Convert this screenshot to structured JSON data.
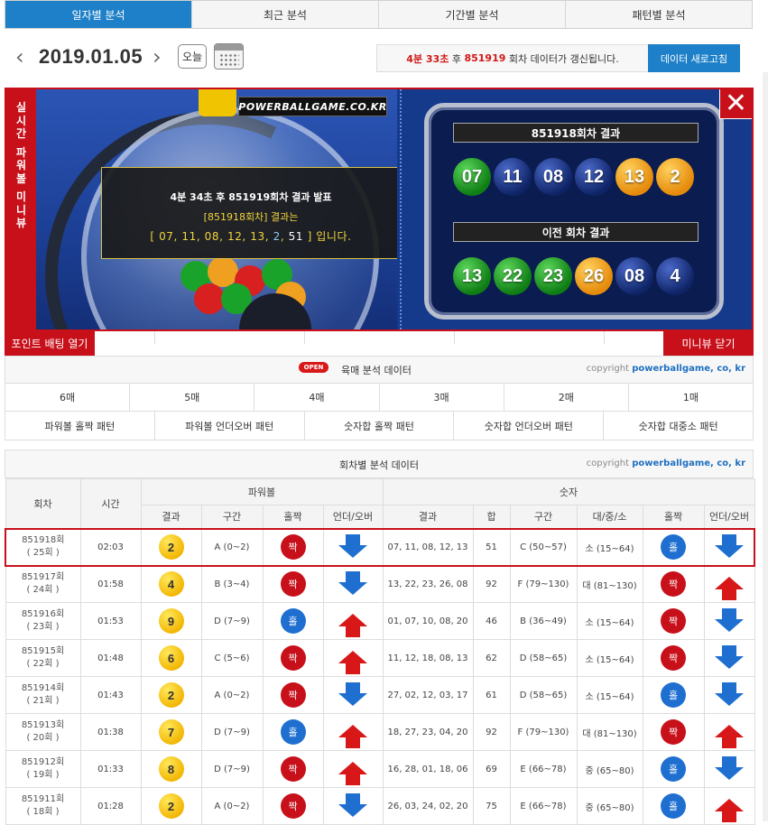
{
  "tabs": [
    "일자별 분석",
    "최근 분석",
    "기간별 분석",
    "패턴별 분석"
  ],
  "date": {
    "value": "2019.01.05",
    "today_label": "오늘"
  },
  "notice": {
    "countdown": "4분 33초",
    "after": " 후 ",
    "round": "851919",
    "text": " 회차 데이터가 갱신됩니다."
  },
  "refresh_label": "데이터 새로고침",
  "mini": {
    "side_label": [
      "실",
      "시",
      "간",
      "파",
      "워",
      "볼",
      "미",
      "니",
      "뷰"
    ],
    "brand": "POWERBALLGAME.CO.KR",
    "announce_l1": "4분 34초 후 851919회차 결과 발표",
    "announce_l2": "[851918회차] 결과는",
    "announce_prefix": "[ 07, 11, 08, 12, 13, ",
    "announce_pb": "2",
    "announce_sep": ", ",
    "announce_sum": "51",
    "announce_suffix": " ] 입니다.",
    "current_title": "851918회차 결과",
    "current_balls": [
      "07",
      "11",
      "08",
      "12",
      "13",
      "2"
    ],
    "prev_title": "이전 회차 결과",
    "prev_balls": [
      "13",
      "22",
      "23",
      "26",
      "08",
      "4"
    ],
    "close": "✕",
    "point_btn": "포인트 배팅 열기",
    "minimize_btn": "미니뷰 닫기"
  },
  "colors": {
    "accent": "#1e80c8",
    "red": "#c8101a",
    "ball_green": "#0e7d14",
    "ball_navy": "#0f2467",
    "ball_orange": "#e58a0a"
  },
  "buy": {
    "badge": "OPEN",
    "title": "육매 분석 데이터",
    "copyright_prefix": "copyright ",
    "copyright_site": "powerballgame, co, kr",
    "counts": [
      "6매",
      "5매",
      "4매",
      "3매",
      "2매",
      "1매"
    ],
    "patterns": [
      "파워볼 홀짝 패턴",
      "파워볼 언더오버 패턴",
      "숫자합 홀짝 패턴",
      "숫자합 언더오버 패턴",
      "숫자합 대중소 패턴"
    ]
  },
  "analysis": {
    "title": "회차별 분석 데이터",
    "copyright_prefix": "copyright ",
    "copyright_site": "powerballgame, co, kr",
    "h_round": "회차",
    "h_time": "시간",
    "h_powerball": "파워볼",
    "h_numbers": "숫자",
    "sub": [
      "결과",
      "구간",
      "홀짝",
      "언더/오버",
      "결과",
      "합",
      "구간",
      "대/중/소",
      "홀짝",
      "언더/오버"
    ],
    "rows": [
      {
        "round": "851918회",
        "sub": "( 25회 )",
        "time": "02:03",
        "pb": "2",
        "pb_range": "A (0~2)",
        "pb_oe": "짝",
        "pb_ud": "down",
        "nums": "07, 11, 08, 12, 13",
        "sum": "51",
        "sum_range": "C (50~57)",
        "size": "소 (15~64)",
        "oe": "홀",
        "ud": "down"
      },
      {
        "round": "851917회",
        "sub": "( 24회 )",
        "time": "01:58",
        "pb": "4",
        "pb_range": "B (3~4)",
        "pb_oe": "짝",
        "pb_ud": "down",
        "nums": "13, 22, 23, 26, 08",
        "sum": "92",
        "sum_range": "F (79~130)",
        "size": "대 (81~130)",
        "oe": "짝",
        "ud": "up"
      },
      {
        "round": "851916회",
        "sub": "( 23회 )",
        "time": "01:53",
        "pb": "9",
        "pb_range": "D (7~9)",
        "pb_oe": "홀",
        "pb_ud": "up",
        "nums": "01, 07, 10, 08, 20",
        "sum": "46",
        "sum_range": "B (36~49)",
        "size": "소 (15~64)",
        "oe": "짝",
        "ud": "down"
      },
      {
        "round": "851915회",
        "sub": "( 22회 )",
        "time": "01:48",
        "pb": "6",
        "pb_range": "C (5~6)",
        "pb_oe": "짝",
        "pb_ud": "up",
        "nums": "11, 12, 18, 08, 13",
        "sum": "62",
        "sum_range": "D (58~65)",
        "size": "소 (15~64)",
        "oe": "짝",
        "ud": "down"
      },
      {
        "round": "851914회",
        "sub": "( 21회 )",
        "time": "01:43",
        "pb": "2",
        "pb_range": "A (0~2)",
        "pb_oe": "짝",
        "pb_ud": "down",
        "nums": "27, 02, 12, 03, 17",
        "sum": "61",
        "sum_range": "D (58~65)",
        "size": "소 (15~64)",
        "oe": "홀",
        "ud": "down"
      },
      {
        "round": "851913회",
        "sub": "( 20회 )",
        "time": "01:38",
        "pb": "7",
        "pb_range": "D (7~9)",
        "pb_oe": "홀",
        "pb_ud": "up",
        "nums": "18, 27, 23, 04, 20",
        "sum": "92",
        "sum_range": "F (79~130)",
        "size": "대 (81~130)",
        "oe": "짝",
        "ud": "up"
      },
      {
        "round": "851912회",
        "sub": "( 19회 )",
        "time": "01:33",
        "pb": "8",
        "pb_range": "D (7~9)",
        "pb_oe": "짝",
        "pb_ud": "up",
        "nums": "16, 28, 01, 18, 06",
        "sum": "69",
        "sum_range": "E (66~78)",
        "size": "중 (65~80)",
        "oe": "홀",
        "ud": "down"
      },
      {
        "round": "851911회",
        "sub": "( 18회 )",
        "time": "01:28",
        "pb": "2",
        "pb_range": "A (0~2)",
        "pb_oe": "짝",
        "pb_ud": "down",
        "nums": "26, 03, 24, 02, 20",
        "sum": "75",
        "sum_range": "E (66~78)",
        "size": "중 (65~80)",
        "oe": "홀",
        "ud": "up"
      }
    ]
  }
}
